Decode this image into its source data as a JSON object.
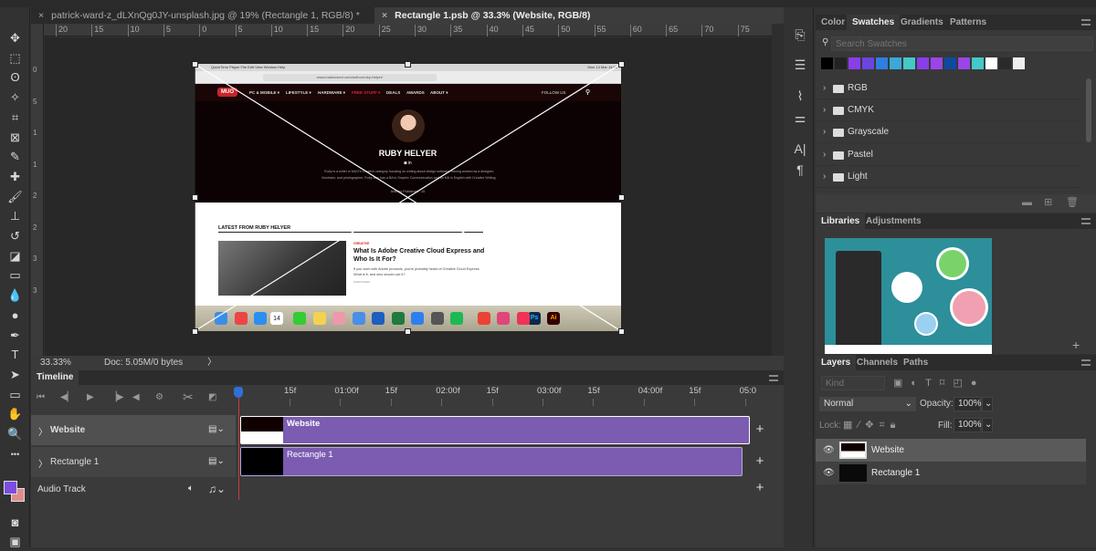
{
  "document_tabs": [
    {
      "title": "patrick-ward-z_dLXnQg0JY-unsplash.jpg @ 19% (Rectangle 1, RGB/8) *",
      "active": false
    },
    {
      "title": "Rectangle 1.psb @ 33.3% (Website, RGB/8)",
      "active": true
    }
  ],
  "ruler": {
    "h_labels": [
      "20",
      "15",
      "10",
      "5",
      "0",
      "5",
      "10",
      "15",
      "20",
      "25",
      "30",
      "35",
      "40",
      "45",
      "50",
      "55",
      "60",
      "65",
      "70",
      "75"
    ],
    "v_labels": [
      "0",
      "5",
      "1",
      "1",
      "2",
      "2",
      "3",
      "3"
    ]
  },
  "tools": [
    {
      "name": "move",
      "glyph": "✥"
    },
    {
      "name": "marquee",
      "glyph": "⬚"
    },
    {
      "name": "lasso",
      "glyph": "ʘ"
    },
    {
      "name": "magic-wand",
      "glyph": "✧"
    },
    {
      "name": "crop",
      "glyph": "⌗"
    },
    {
      "name": "frame",
      "glyph": "⊠"
    },
    {
      "name": "eyedropper",
      "glyph": "✎"
    },
    {
      "name": "healing-brush",
      "glyph": "✚"
    },
    {
      "name": "brush",
      "glyph": "🖌"
    },
    {
      "name": "clone-stamp",
      "glyph": "⊥"
    },
    {
      "name": "history-brush",
      "glyph": "↺"
    },
    {
      "name": "eraser",
      "glyph": "◪"
    },
    {
      "name": "gradient",
      "glyph": "▭"
    },
    {
      "name": "blur",
      "glyph": "💧"
    },
    {
      "name": "dodge",
      "glyph": "●"
    },
    {
      "name": "pen",
      "glyph": "✒"
    },
    {
      "name": "type",
      "glyph": "T"
    },
    {
      "name": "path-selection",
      "glyph": "➤"
    },
    {
      "name": "rectangle",
      "glyph": "▭"
    },
    {
      "name": "hand",
      "glyph": "✋"
    },
    {
      "name": "zoom",
      "glyph": "🔍"
    },
    {
      "name": "more",
      "glyph": "•••"
    }
  ],
  "colors": {
    "foreground": "#7b4ee0",
    "background": "#e08c8c",
    "accent_clip": "#7b5cb0",
    "playhead": "#2f6fd6"
  },
  "status": {
    "zoom": "33.33%",
    "doc": "Doc: 5.05M/0 bytes",
    "arrow": "〉"
  },
  "website": {
    "menubar": "QuickTime Player   File   Edit   View   Window   Help",
    "clock": "Mon 14 Mar 14:51",
    "url": "www.makeuseof.com/author/ruby-helyer/",
    "logo": "MUO",
    "nav": [
      "PC & MOBILE ▾",
      "LIFESTYLE ▾",
      "HARDWARE ▾",
      "FREE STUFF ▾",
      "DEALS",
      "AWARDS",
      "ABOUT ▾"
    ],
    "follow": "FOLLOW US",
    "author": "RUBY HELYER",
    "social": "◙  in",
    "bio": "Ruby is a writer in MUO's Creative category focusing on writing about design software. Having worked as a designer, illustrator, and photographer, Ruby also has a BA in Graphic Communication and an MA in English with Creative Writing.",
    "articles": "Articles Published : 15",
    "latest_heading": "LATEST FROM RUBY HELYER",
    "category": "CREATIVE",
    "article_title": "What Is Adobe Creative Cloud Express and Who Is It For?",
    "article_excerpt": "If you work with Adobe products, you're probably heard of Creative Cloud Express. What is it, and who should use it?",
    "article_date": "2 DAYS AGO",
    "calendar_day": "14",
    "ps_label": "Ps",
    "ai_label": "Ai"
  },
  "timeline": {
    "title": "Timeline",
    "ruler": [
      "15f",
      "01:00f",
      "15f",
      "02:00f",
      "15f",
      "03:00f",
      "15f",
      "04:00f",
      "15f",
      "05:0"
    ],
    "tracks": [
      {
        "name": "Website",
        "clip": "Website"
      },
      {
        "name": "Rectangle 1",
        "clip": "Rectangle 1"
      }
    ],
    "audio": "Audio Track",
    "add": "+"
  },
  "swatches_panel": {
    "tabs": [
      "Color",
      "Swatches",
      "Gradients",
      "Patterns"
    ],
    "active_tab": "Swatches",
    "search_placeholder": "Search Swatches",
    "recent": [
      "#000000",
      "#232323",
      "#8a3ee8",
      "#6a45e0",
      "#2f7fe0",
      "#3aa8d8",
      "#44c8c8",
      "#8a3ee8",
      "#9b45e8",
      "#0d4aa0",
      "#9b45e8",
      "#44c8c8",
      "#ffffff",
      "#2a2a2a",
      "#eeeeee"
    ],
    "groups": [
      "RGB",
      "CMYK",
      "Grayscale",
      "Pastel",
      "Light"
    ]
  },
  "libraries_panel": {
    "tabs": [
      "Libraries",
      "Adjustments"
    ],
    "active_tab": "Libraries"
  },
  "layers_panel": {
    "tabs": [
      "Layers",
      "Channels",
      "Paths"
    ],
    "active_tab": "Layers",
    "kind_placeholder": "Kind",
    "blend_mode": "Normal",
    "opacity_label": "Opacity:",
    "opacity": "100%",
    "lock_label": "Lock:",
    "fill_label": "Fill:",
    "fill": "100%",
    "layers": [
      {
        "name": "Website",
        "selected": true,
        "visible": true
      },
      {
        "name": "Rectangle 1",
        "selected": false,
        "visible": true
      }
    ]
  }
}
